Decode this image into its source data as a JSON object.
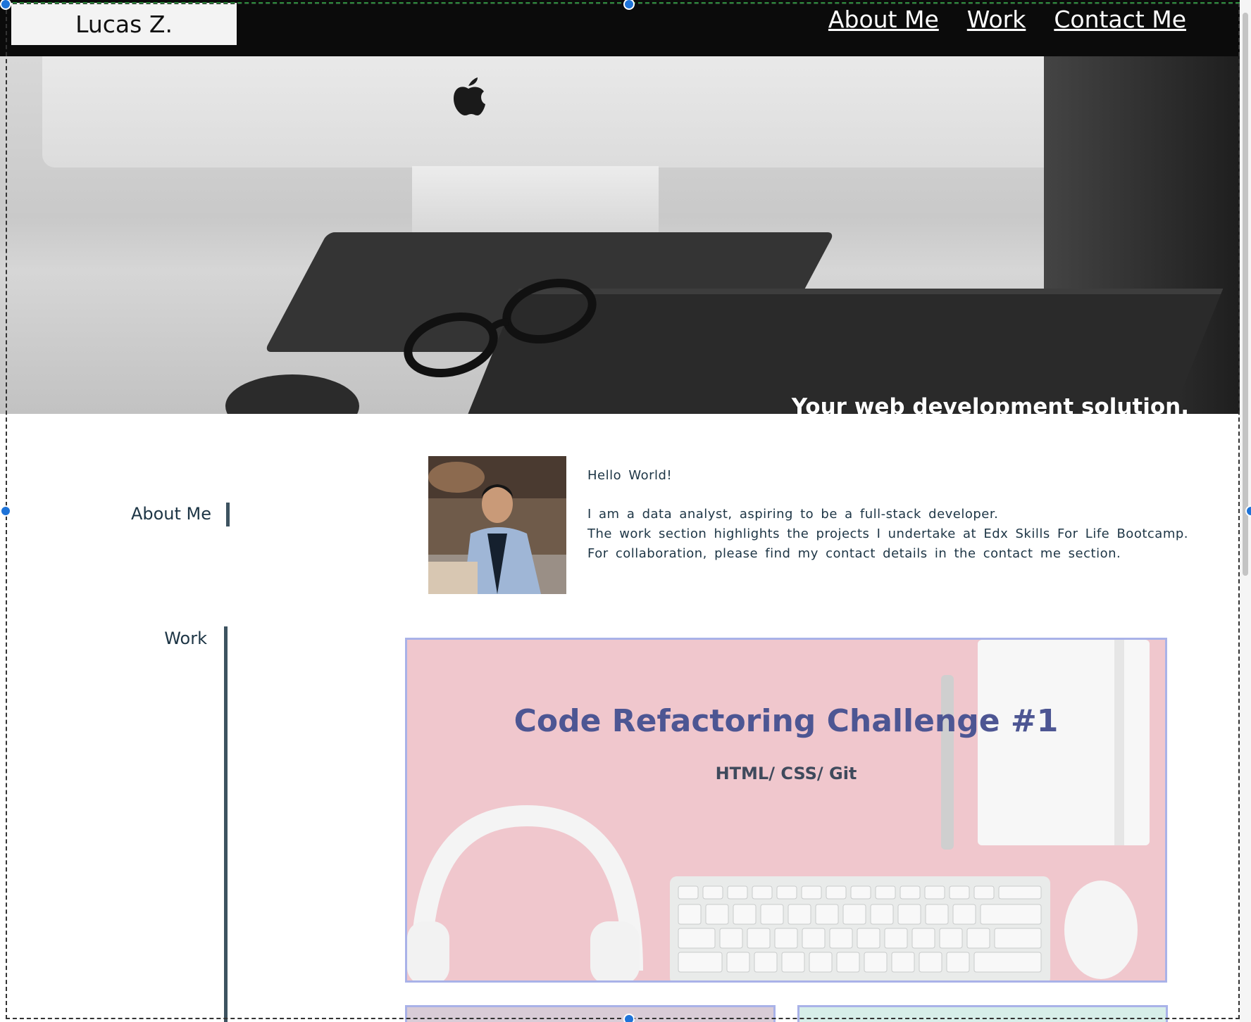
{
  "header": {
    "brand": "Lucas Z.",
    "nav": [
      {
        "label": "About Me"
      },
      {
        "label": "Work"
      },
      {
        "label": "Contact Me"
      }
    ]
  },
  "hero": {
    "tagline": "Your web development solution."
  },
  "sections": {
    "about_label": "About Me",
    "work_label": "Work"
  },
  "about": {
    "greeting": "Hello World!",
    "lines": [
      "I am a data analyst, aspiring to be a full-stack developer.",
      "The work section highlights the projects I undertake at Edx Skills For Life Bootcamp.",
      "For collaboration, please find my contact details in the contact me section."
    ]
  },
  "work": {
    "featured": {
      "title": "Code Refactoring Challenge #1",
      "subtitle": "HTML/ CSS/ Git"
    }
  },
  "colors": {
    "header_bg": "#0b0b0b",
    "accent_text": "#1d3545",
    "card_title": "#4d5693",
    "card_border": "#a9b2e8",
    "card_bg": "#f0c7cd",
    "selection_handle": "#1e73d8"
  }
}
